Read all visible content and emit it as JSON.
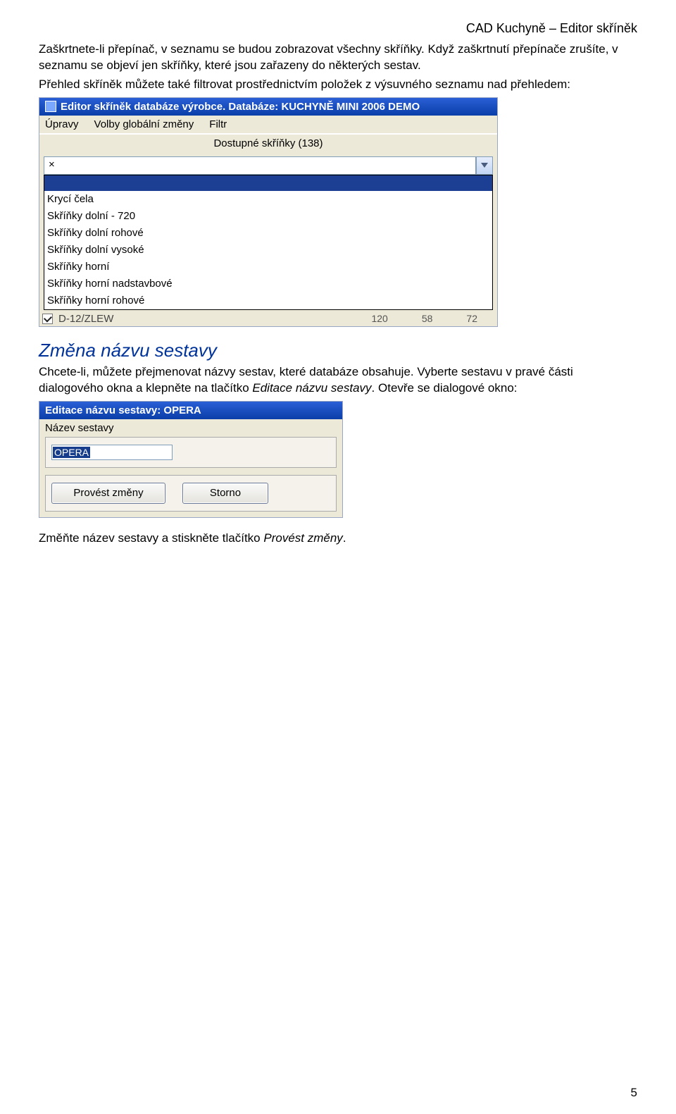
{
  "header": "CAD Kuchyně – Editor skříněk",
  "intro_text": "Zaškrtnete-li přepínač, v seznamu se budou zobrazovat všechny skříňky. Když zaškrtnutí přepínače zrušíte, v seznamu se objeví jen skříňky, které jsou zařazeny do některých sestav.",
  "intro_text2": "Přehled skříněk můžete také filtrovat prostřednictvím položek z výsuvného seznamu nad přehledem:",
  "app_window": {
    "title": "Editor skříněk databáze výrobce. Databáze: KUCHYNĚ MINI 2006 DEMO",
    "menu": [
      "Úpravy",
      "Volby globální změny",
      "Filtr"
    ],
    "caption": "Dostupné skříňky (138)",
    "combo_value": "×",
    "drop_items": [
      "Krycí čela",
      "Skříňky dolní - 720",
      "Skříňky dolní rohové",
      "Skříňky dolní vysoké",
      "Skříňky horní",
      "Skříňky horní nadstavbové",
      "Skříňky horní rohové"
    ],
    "partial_row_label": "D-12/ZLEW",
    "partial_nums": [
      "120",
      "58",
      "72"
    ]
  },
  "section_title": "Změna názvu sestavy",
  "section_text_a": "Chcete-li, můžete přejmenovat názvy sestav, které databáze obsahuje. Vyberte sestavu v pravé části dialogového okna a klepněte na tlačítko ",
  "section_text_italic": "Editace názvu sestavy",
  "section_text_b": ". Otevře se dialogové okno:",
  "dialog2": {
    "title": "Editace názvu sestavy: OPERA",
    "label": "Název sestavy",
    "value": "OPERA",
    "btn_primary": "Provést změny",
    "btn_cancel": "Storno"
  },
  "closing_text_a": "Změňte název sestavy a stiskněte tlačítko ",
  "closing_text_italic": "Provést změny",
  "closing_text_b": ".",
  "page_number": "5"
}
